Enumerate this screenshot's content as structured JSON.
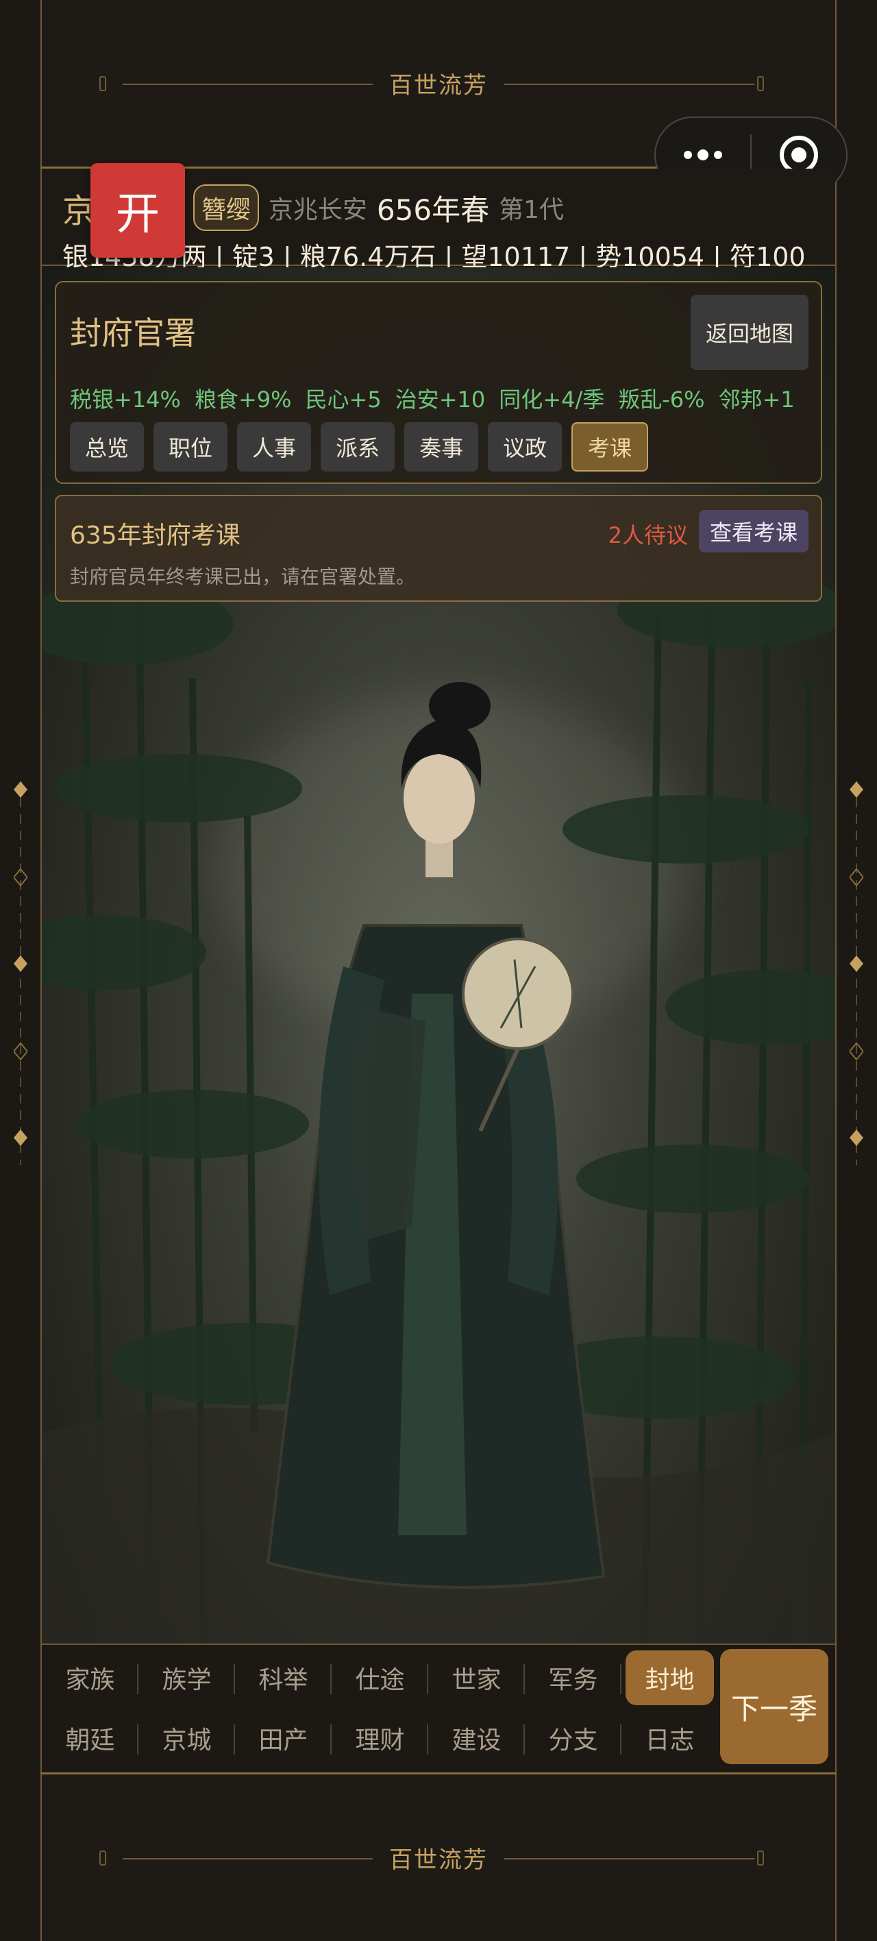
{
  "banner": {
    "title": "百世流芳"
  },
  "header": {
    "clan": "京兆X氏",
    "rank_badge": "簪缨",
    "place": "京兆长安",
    "year": "656年春",
    "generation": "第1代",
    "resources": "银1438万两 | 锭3 | 粮76.4万石 | 望10117 | 势10054 | 符100"
  },
  "open_button": "开",
  "panel": {
    "title": "封府官署",
    "back_button": "返回地图",
    "stats": [
      "税银+14%",
      "粮食+9%",
      "民心+5",
      "治安+10",
      "同化+4/季",
      "叛乱-6%",
      "邻邦+1"
    ],
    "tabs": [
      "总览",
      "职位",
      "人事",
      "派系",
      "奏事",
      "议政",
      "考课"
    ],
    "active_tab": "考课"
  },
  "exam": {
    "title": "635年封府考课",
    "pending": "2人待议",
    "button": "查看考课",
    "description": "封府官员年终考课已出，请在官署处置。"
  },
  "nav": {
    "row1": [
      "家族",
      "族学",
      "科举",
      "仕途",
      "世家",
      "军务",
      "封地"
    ],
    "row2": [
      "朝廷",
      "京城",
      "田产",
      "理财",
      "建设",
      "分支",
      "日志"
    ],
    "active": "封地",
    "next_button": "下一季"
  },
  "colors": {
    "gold": "#c7a160",
    "stat_green": "#6fc67a",
    "pending_red": "#e05a42",
    "open_red": "#d03a36",
    "nav_active": "#9b6a30"
  }
}
